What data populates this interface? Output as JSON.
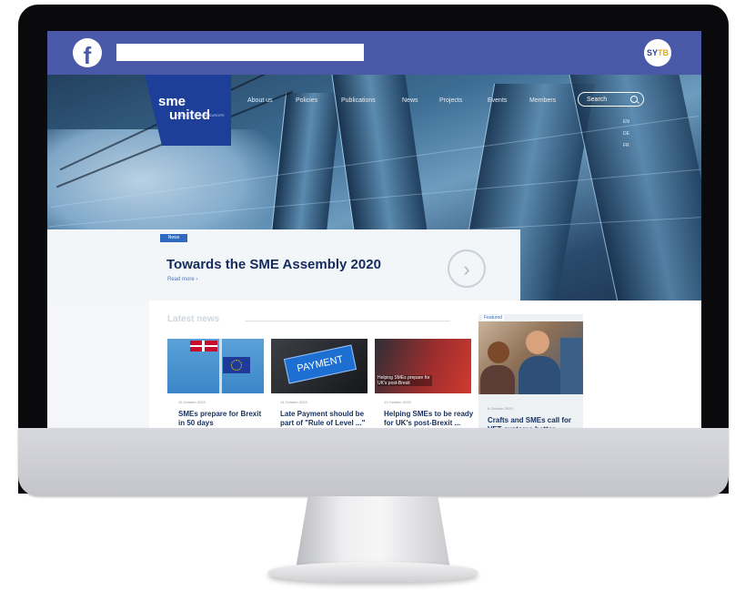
{
  "browser": {
    "url_value": "",
    "avatar_text": "SY",
    "avatar_accent": "TB"
  },
  "site": {
    "logo_line1": "sme",
    "logo_line2": "united",
    "logo_tagline": "CRAFTS & SMEs IN EUROPE",
    "nav": [
      "About us",
      "Policies",
      "Publications",
      "News",
      "Projects",
      "Events",
      "Members"
    ],
    "search_placeholder": "Search",
    "languages": [
      "EN",
      "DE",
      "FR"
    ]
  },
  "feature": {
    "tag": "News",
    "title": "Towards the SME Assembly 2020",
    "read_more": "Read more ›"
  },
  "latest": {
    "heading": "Latest news",
    "cards": [
      {
        "date": "15 October 2020",
        "title": "SMEs prepare for Brexit in 50 days"
      },
      {
        "date": "14 October 2020",
        "title": "Late Payment should be part of \"Rule of Level ...\""
      },
      {
        "date": "13 October 2020",
        "title": "Helping SMEs to be ready for UK's post-Brexit ..."
      }
    ],
    "card2_sign": "PAYMENT",
    "card3_caption": "Helping SMEs prepare for UK's post-Brexit"
  },
  "featured": {
    "tag": "Featured",
    "date": "8 October 2020",
    "title": "Crafts and SMEs call for VET systems better"
  },
  "colors": {
    "facebook_blue": "#4a59a7",
    "brand_navy": "#142b5e",
    "accent_blue": "#2f6ac0"
  }
}
